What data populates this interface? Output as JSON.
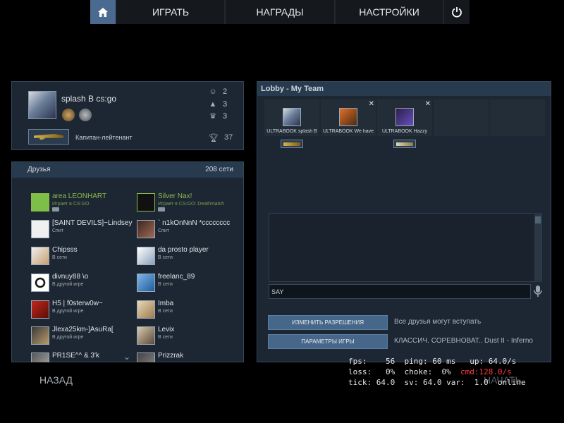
{
  "nav": {
    "play": "ИГРАТЬ",
    "awards": "НАГРАДЫ",
    "settings": "НАСТРОЙКИ",
    "home_icon": "home-icon",
    "power_icon": "power-icon"
  },
  "profile": {
    "name": "splash B cs:go",
    "stats": {
      "friendly": "2",
      "teacher": "3",
      "leader": "3"
    },
    "rank_name": "Капитан-лейтенант",
    "trophies": "37"
  },
  "friends": {
    "title": "Друзья",
    "online_count": "208 сети",
    "items": [
      {
        "name": "area LEONHART",
        "status": "Играет в CS:GO",
        "playing": true
      },
      {
        "name": "Silver Nax!",
        "status": "Играет в CS:GO: Deathmatch",
        "playing": true
      },
      {
        "name": "[SAINT DEVILS]~Lindsey",
        "status": "Спит",
        "playing": false
      },
      {
        "name": "` n1kOnNnN *cccccccc",
        "status": "Спит",
        "playing": false
      },
      {
        "name": "Chipsss",
        "status": "В сети",
        "playing": false
      },
      {
        "name": "da prosto player",
        "status": "В сети",
        "playing": false
      },
      {
        "name": "divnuy88 \\o",
        "status": "В другой игре",
        "playing": false
      },
      {
        "name": "freelanc_89",
        "status": "В сети",
        "playing": false
      },
      {
        "name": "H5 | f0sterw0w~",
        "status": "В другой игре",
        "playing": false
      },
      {
        "name": "Imba",
        "status": "В сети",
        "playing": false
      },
      {
        "name": "Jlexa25km-]AsuRa[",
        "status": "В другой игре",
        "playing": false
      },
      {
        "name": "Levix",
        "status": "В сети",
        "playing": false
      },
      {
        "name": "PR1SE^^ & 3'k",
        "status": "",
        "playing": false
      },
      {
        "name": "Prizzrak",
        "status": "",
        "playing": false
      }
    ]
  },
  "lobby": {
    "title": "Lobby - My Team",
    "members": [
      {
        "name": "ULTRABOOK splash B"
      },
      {
        "name": "ULTRABOOK We have"
      },
      {
        "name": "ULTRABOOK Hazzy"
      }
    ],
    "say_prefix": "SAY",
    "change_permissions": "ИЗМЕНИТЬ РАЗРЕШЕНИЯ",
    "permissions_info": "Все друзья могут вступать",
    "game_params": "ПАРАМЕТРЫ ИГРЫ",
    "params_info": "КЛАССИЧ. СОРЕВНОВАТ.. Dust II - Inferno"
  },
  "bottom": {
    "back": "НАЗАД",
    "start": "НАЧАТЬ"
  },
  "netgraph": {
    "line1a": "fps:    56  ping: 60 ms",
    "line1b": "up: 64.0/s",
    "line2a": "loss:   0%  choke:  0%",
    "line2b": "cmd:128.0/s",
    "line3a": "tick: 64.0  sv: 64.0 var:  1.0",
    "line3b": "online"
  },
  "colors": {
    "accent": "#4a6b8f",
    "panel": "#1c2733",
    "playing_green": "#8fb84c",
    "net_red": "#ff3b3b"
  }
}
